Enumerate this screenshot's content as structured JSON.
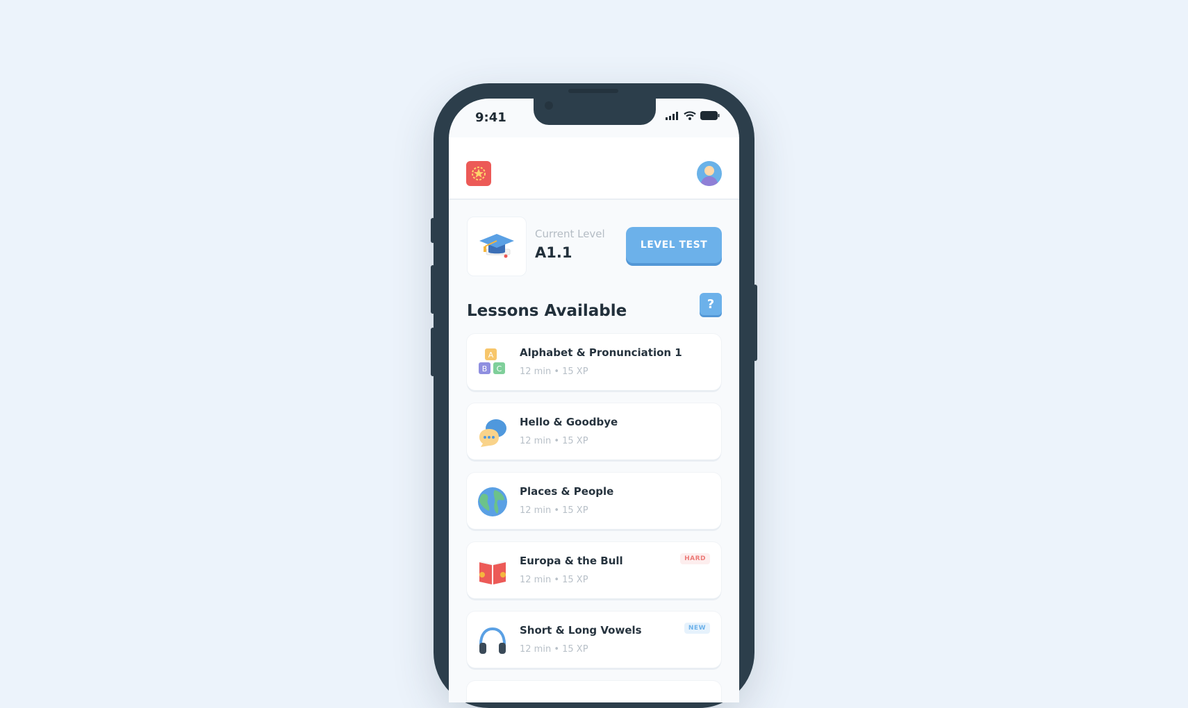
{
  "status": {
    "time": "9:41"
  },
  "level": {
    "label": "Current Level",
    "value": "A1.1",
    "button": "LEVEL TEST"
  },
  "lessons_section": {
    "title": "Lessons Available",
    "help": "?"
  },
  "lessons": [
    {
      "name": "Alphabet & Pronunciation 1",
      "meta": "12 min • 15 XP",
      "icon": "alphabet-blocks-icon",
      "badge": ""
    },
    {
      "name": "Hello & Goodbye",
      "meta": "12 min • 15 XP",
      "icon": "speech-bubbles-icon",
      "badge": ""
    },
    {
      "name": "Places & People",
      "meta": "12 min • 15 XP",
      "icon": "globe-icon",
      "badge": ""
    },
    {
      "name": "Europa & the Bull",
      "meta": "12 min • 15 XP",
      "icon": "book-icon",
      "badge": "HARD"
    },
    {
      "name": "Short & Long Vowels",
      "meta": "12 min • 15 XP",
      "icon": "headphones-icon",
      "badge": "NEW"
    }
  ],
  "colors": {
    "background": "#ecf3fb",
    "phone_frame": "#2c3e4b",
    "accent": "#6cb1ea",
    "logo": "#ec5a57",
    "badge_hard": "#ec7b78"
  }
}
